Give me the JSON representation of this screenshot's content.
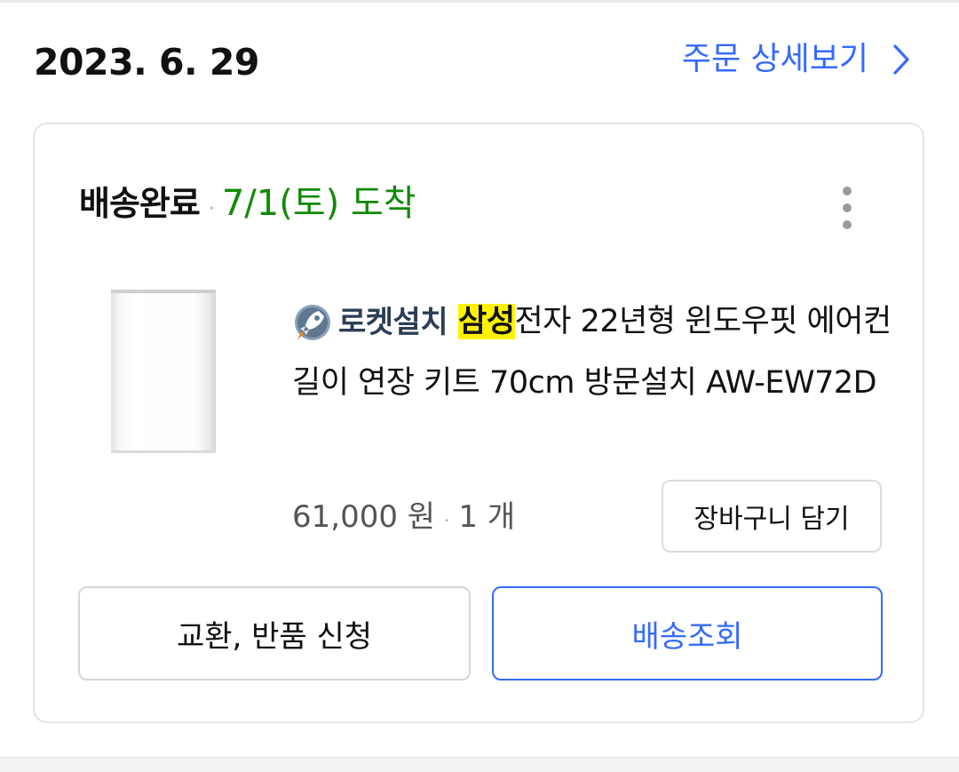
{
  "order": {
    "date": "2023. 6. 29",
    "detail_link_label": "주문 상세보기"
  },
  "shipment": {
    "status": "배송완료",
    "separator": "·",
    "arrival": "7/1(토) 도착"
  },
  "product": {
    "badge_label": "로켓설치",
    "brand_highlight": "삼성",
    "title_rest": "전자 22년형 윈도우핏 에어컨 길이 연장 키트 70cm 방문설치 AW-EW72D",
    "price": "61,000 원",
    "price_separator": "·",
    "quantity": "1 개",
    "thumbnail_icon": "product-thumbnail-image"
  },
  "buttons": {
    "add_to_cart": "장바구니 담기",
    "return_exchange": "교환, 반품 신청",
    "track_delivery": "배송조회"
  },
  "icons": {
    "detail_chevron": "chevron-right-icon",
    "more_menu": "kebab-menu-icon",
    "rocket_badge": "rocket-icon"
  },
  "colors": {
    "accent_blue": "#346aff",
    "arrival_green": "#118a08",
    "brand_highlight_yellow": "#fff200"
  }
}
